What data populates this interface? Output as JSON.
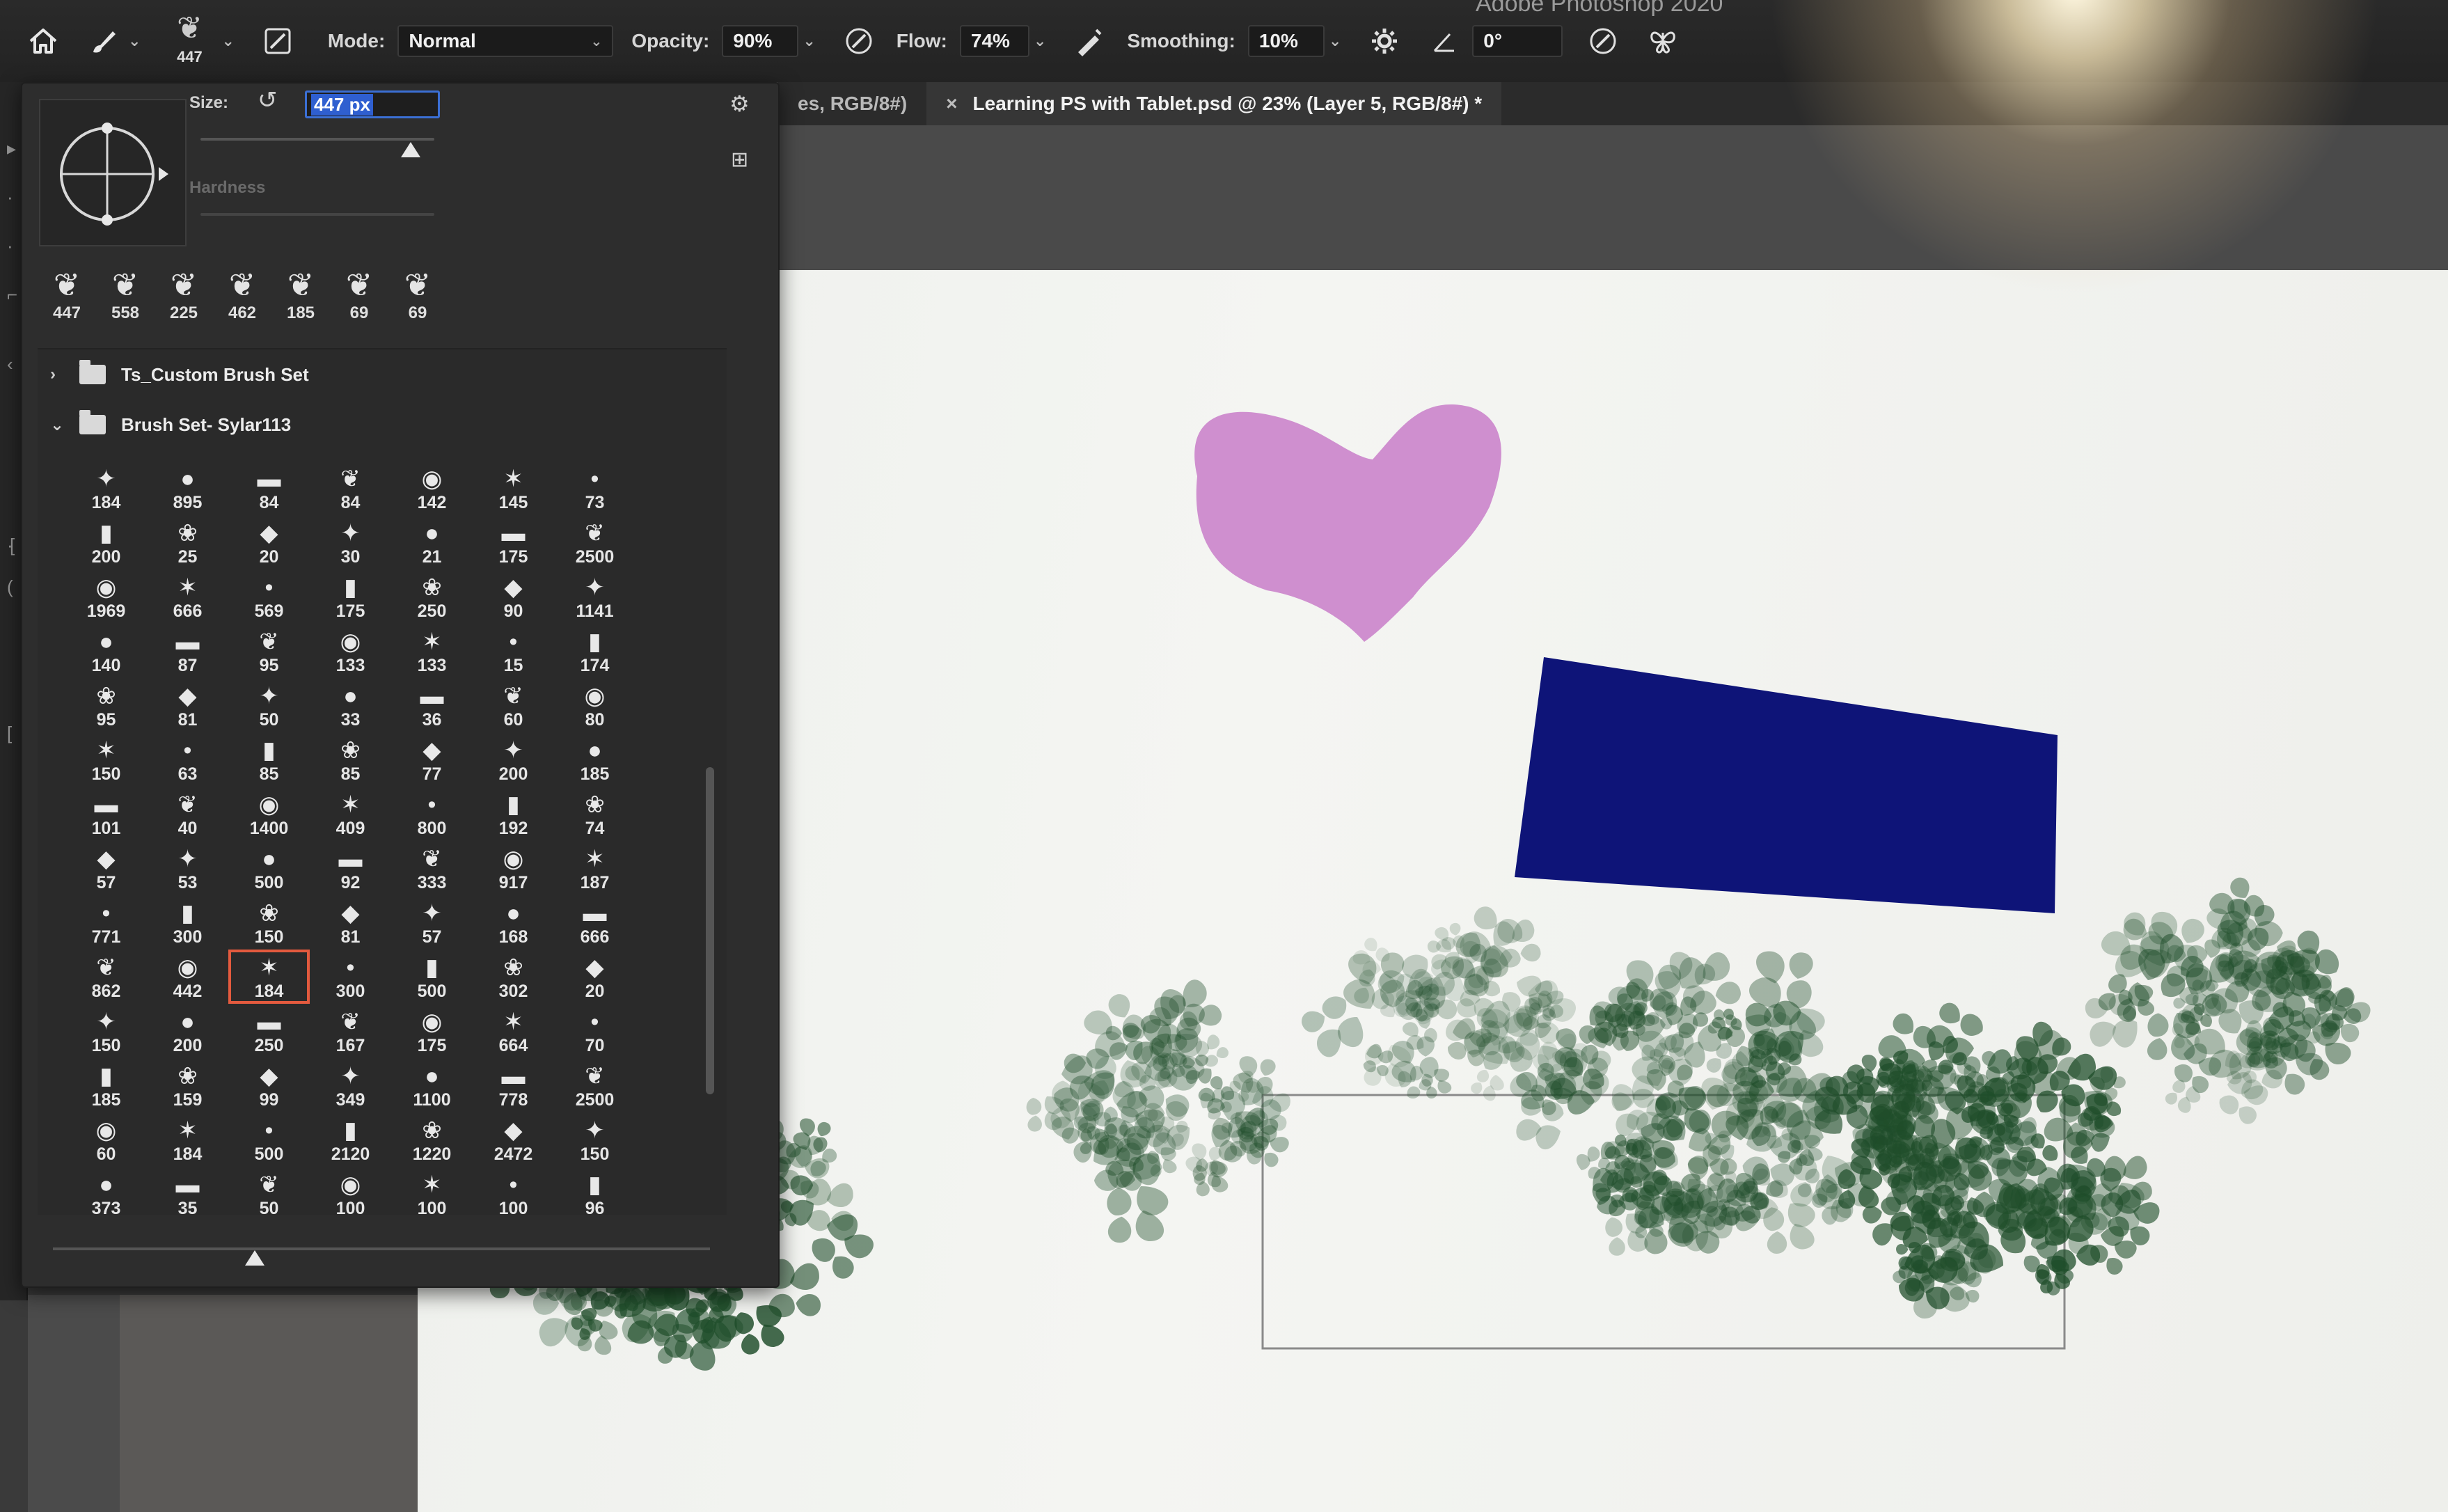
{
  "app": {
    "title": "Adobe Photoshop 2020"
  },
  "options_bar": {
    "home_icon": "home-icon",
    "tool_icon": "brush-tool-icon",
    "brush_preset_size": "447",
    "mode_label": "Mode:",
    "mode_value": "Normal",
    "opacity_label": "Opacity:",
    "opacity_value": "90%",
    "flow_label": "Flow:",
    "flow_value": "74%",
    "smoothing_label": "Smoothing:",
    "smoothing_value": "10%",
    "angle_value": "0°"
  },
  "document_tabs": [
    {
      "label": "es, RGB/8#)",
      "active": false
    },
    {
      "label": "Learning PS with Tablet.psd @ 23% (Layer 5, RGB/8#) *",
      "active": true
    }
  ],
  "brush_panel": {
    "size_label": "Size:",
    "size_value": "447 px",
    "size_slider_fraction": 0.9,
    "hardness_label": "Hardness",
    "recent_brushes": [
      "447",
      "558",
      "225",
      "462",
      "185",
      "69",
      "69"
    ],
    "groups": [
      {
        "name": "Ts_Custom Brush Set",
        "expanded": false
      },
      {
        "name": "Brush Set- Sylar113",
        "expanded": true
      }
    ],
    "selected_index": 65,
    "brush_sizes": [
      "184",
      "895",
      "84",
      "84",
      "142",
      "145",
      "73",
      "200",
      "25",
      "20",
      "30",
      "21",
      "175",
      "2500",
      "1969",
      "666",
      "569",
      "175",
      "250",
      "90",
      "1141",
      "140",
      "87",
      "95",
      "133",
      "133",
      "15",
      "174",
      "95",
      "81",
      "50",
      "33",
      "36",
      "60",
      "80",
      "150",
      "63",
      "85",
      "85",
      "77",
      "200",
      "185",
      "101",
      "40",
      "1400",
      "409",
      "800",
      "192",
      "74",
      "57",
      "53",
      "500",
      "92",
      "333",
      "917",
      "187",
      "771",
      "300",
      "150",
      "81",
      "57",
      "168",
      "666",
      "862",
      "442",
      "184",
      "300",
      "500",
      "302",
      "20",
      "150",
      "200",
      "250",
      "167",
      "175",
      "664",
      "70",
      "185",
      "159",
      "99",
      "349",
      "1100",
      "778",
      "2500",
      "60",
      "184",
      "500",
      "2120",
      "1220",
      "2472",
      "150",
      "373",
      "35",
      "50",
      "100",
      "100",
      "100",
      "96"
    ]
  },
  "canvas": {
    "heart_color": "#cf8fcf",
    "rectangle_color": "#0e1478",
    "foliage_color": "#1f4d2a"
  }
}
